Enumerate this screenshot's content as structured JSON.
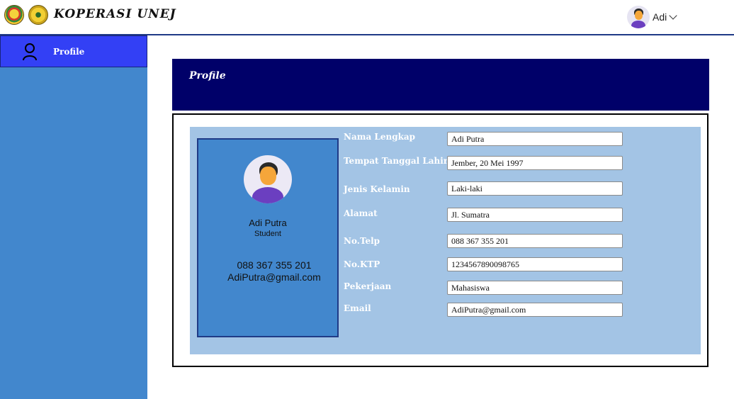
{
  "header": {
    "brand": "KOPERASI UNEJ",
    "user_name": "Adi"
  },
  "sidebar": {
    "items": [
      {
        "label": "Profile",
        "icon": "user-icon"
      }
    ]
  },
  "page": {
    "title": "Profile"
  },
  "profile_card": {
    "name": "Adi Putra",
    "role": "Student",
    "phone": "088 367 355 201",
    "email": "AdiPutra@gmail.com"
  },
  "form": {
    "fields": [
      {
        "label": "Nama Lengkap",
        "value": "Adi Putra"
      },
      {
        "label": "Tempat Tanggal Lahir",
        "value": "Jember, 20 Mei 1997"
      },
      {
        "label": "Jenis Kelamin",
        "value": "Laki-laki"
      },
      {
        "label": "Alamat",
        "value": "Jl. Sumatra"
      },
      {
        "label": "No.Telp",
        "value": "088 367 355 201"
      },
      {
        "label": "No.KTP",
        "value": "1234567890098765"
      },
      {
        "label": "Pekerjaan",
        "value": "Mahasiswa"
      },
      {
        "label": "Email",
        "value": "AdiPutra@gmail.com"
      }
    ]
  },
  "colors": {
    "sidebar": "#4287cd",
    "sidebar_active": "#3340f5",
    "header_band": "#000069",
    "form_panel": "#a3c4e5"
  }
}
